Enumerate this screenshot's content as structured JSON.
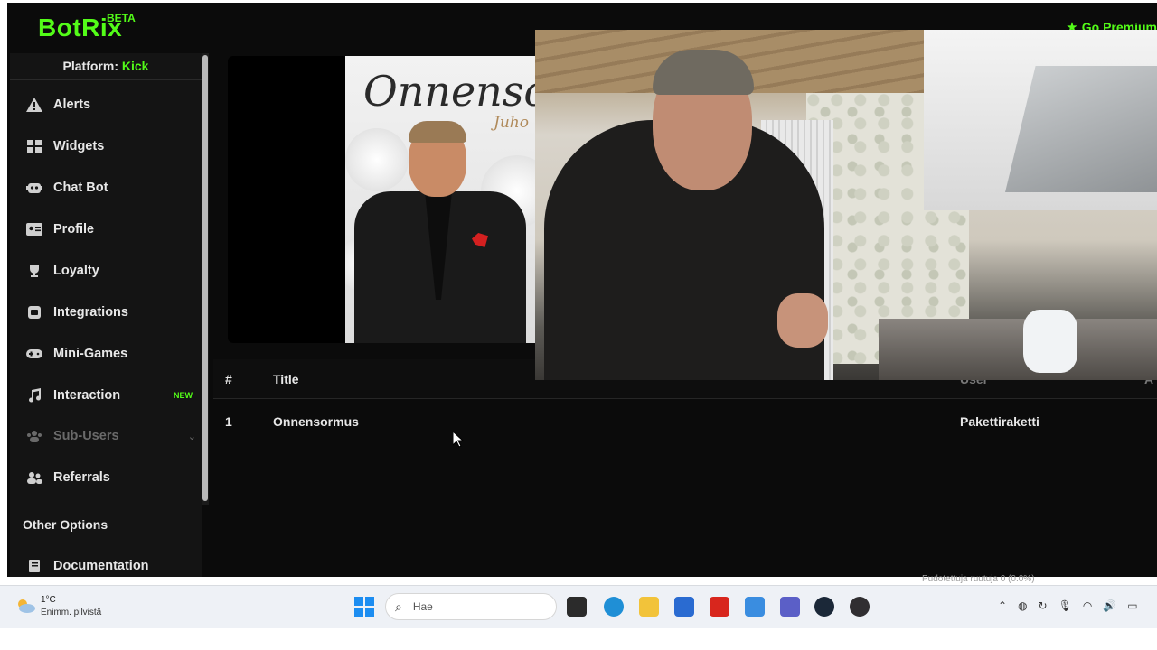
{
  "header": {
    "logo": "BotRix",
    "logo_badge": "BETA",
    "premium_label": "Go Premium",
    "premium_icon": "star-icon"
  },
  "sidebar": {
    "platform_prefix": "Platform:",
    "platform_value": "Kick",
    "items": [
      {
        "label": "Alerts",
        "icon": "warning-icon"
      },
      {
        "label": "Widgets",
        "icon": "grid-icon"
      },
      {
        "label": "Chat Bot",
        "icon": "robot-icon"
      },
      {
        "label": "Profile",
        "icon": "id-card-icon"
      },
      {
        "label": "Loyalty",
        "icon": "trophy-icon"
      },
      {
        "label": "Integrations",
        "icon": "plug-icon"
      },
      {
        "label": "Mini-Games",
        "icon": "gamepad-icon"
      },
      {
        "label": "Interaction",
        "icon": "music-icon",
        "badge": "NEW"
      },
      {
        "label": "Sub-Users",
        "icon": "users-icon"
      },
      {
        "label": "Referrals",
        "icon": "user-group-icon"
      }
    ],
    "section_title": "Other Options",
    "docs_label": "Documentation"
  },
  "album": {
    "title": "Onnensor",
    "artist": "Juho"
  },
  "table": {
    "headers": [
      "#",
      "Title",
      "User",
      "A"
    ],
    "rows": [
      {
        "num": "1",
        "title": "Onnensormus",
        "user": "Pakettiraketti"
      }
    ]
  },
  "taskbar": {
    "temperature": "1°C",
    "weather": "Enimm. pilvistä",
    "search_placeholder": "Hae",
    "status_strip": "Pudotettuja ruutuja 0 (0.0%)"
  },
  "colors": {
    "accent": "#53fc18",
    "background": "#0b0b0b",
    "sidebar": "#141414"
  }
}
